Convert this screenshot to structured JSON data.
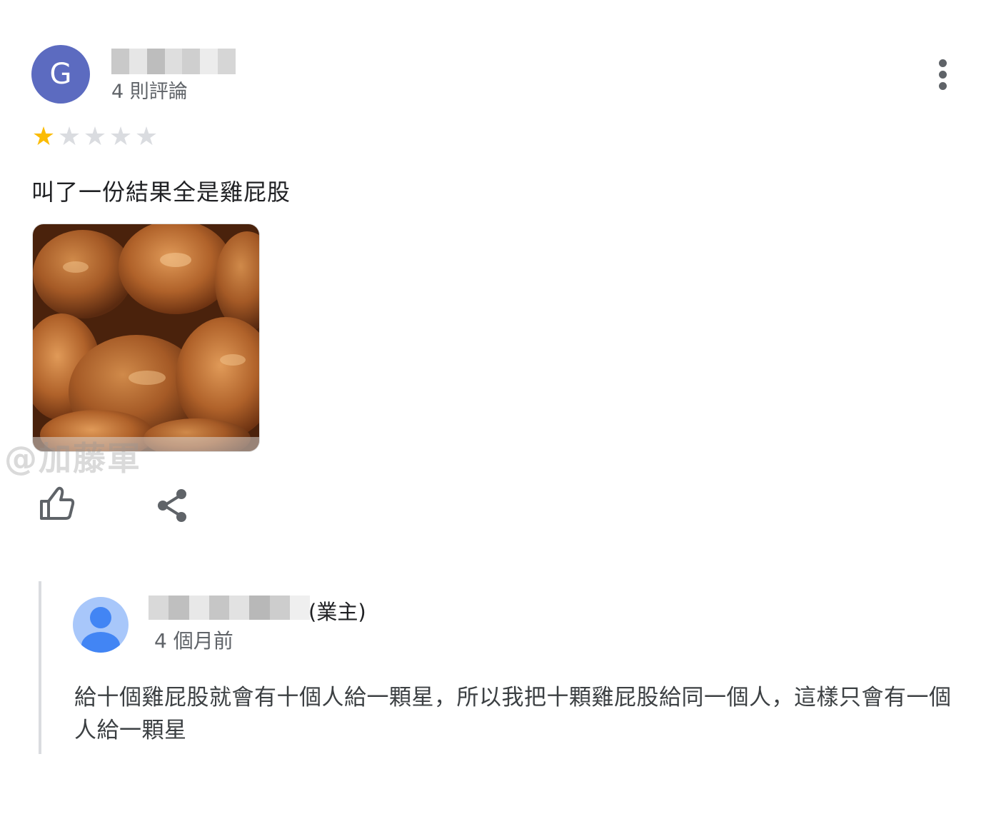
{
  "reviewer": {
    "avatar_letter": "G",
    "avatar_color": "#5c6bc0",
    "review_count": "4 則評論"
  },
  "review": {
    "rating": 1,
    "max_rating": 5,
    "star_filled_color": "#fbbc04",
    "star_empty_color": "#dadce0",
    "text": "叫了一份結果全是雞屁股",
    "photo": "fried-chicken-photo"
  },
  "watermark": "@加藤軍",
  "actions": {
    "like_icon": "thumbs-up-icon",
    "share_icon": "share-icon",
    "more_icon": "more-vert-icon"
  },
  "owner_reply": {
    "owner_tag": "(業主)",
    "time": "4 個月前",
    "text": "給十個雞屁股就會有十個人給一顆星，所以我把十顆雞屁股給同一個人，這樣只會有一個人給一顆星"
  }
}
